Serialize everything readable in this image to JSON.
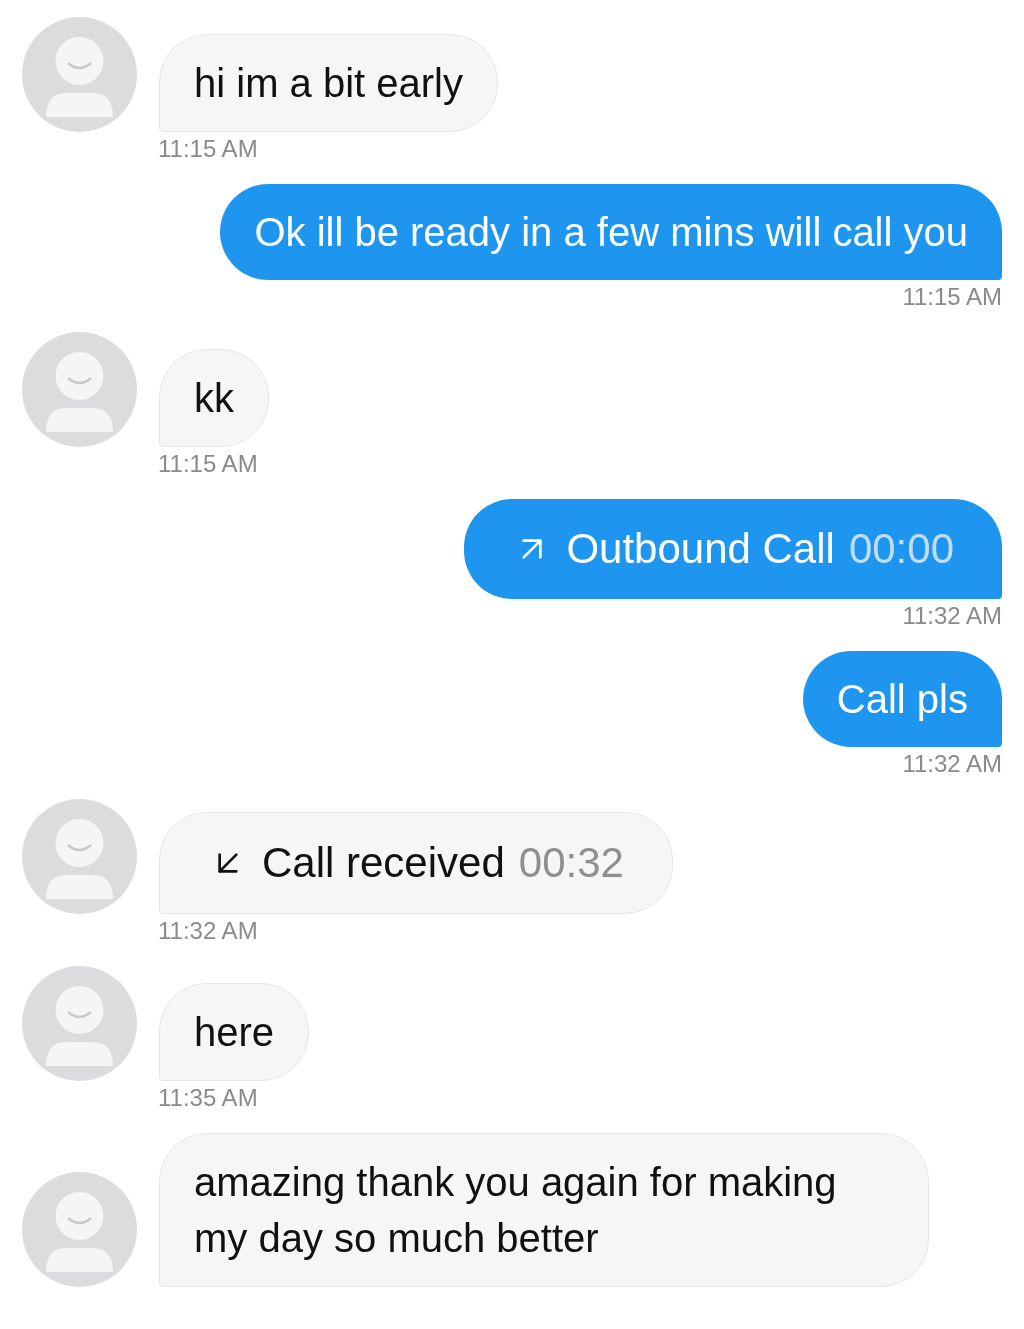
{
  "messages": [
    {
      "outgoing": false,
      "kind": "text",
      "text": "hi im a bit early",
      "time": "11:15 AM"
    },
    {
      "outgoing": true,
      "kind": "text",
      "text": "Ok ill be ready in a few mins will call you",
      "time": "11:15 AM"
    },
    {
      "outgoing": false,
      "kind": "text",
      "text": "kk",
      "time": "11:15 AM"
    },
    {
      "outgoing": true,
      "kind": "call",
      "label": "Outbound Call",
      "duration": "00:00",
      "time": "11:32 AM"
    },
    {
      "outgoing": true,
      "kind": "text",
      "text": "Call pls",
      "time": "11:32 AM"
    },
    {
      "outgoing": false,
      "kind": "call",
      "label": "Call received",
      "duration": "00:32",
      "time": "11:32 AM"
    },
    {
      "outgoing": false,
      "kind": "text",
      "text": "here",
      "time": "11:35 AM"
    },
    {
      "outgoing": false,
      "kind": "text",
      "text": "amazing thank you again for making my day so much better"
    }
  ]
}
